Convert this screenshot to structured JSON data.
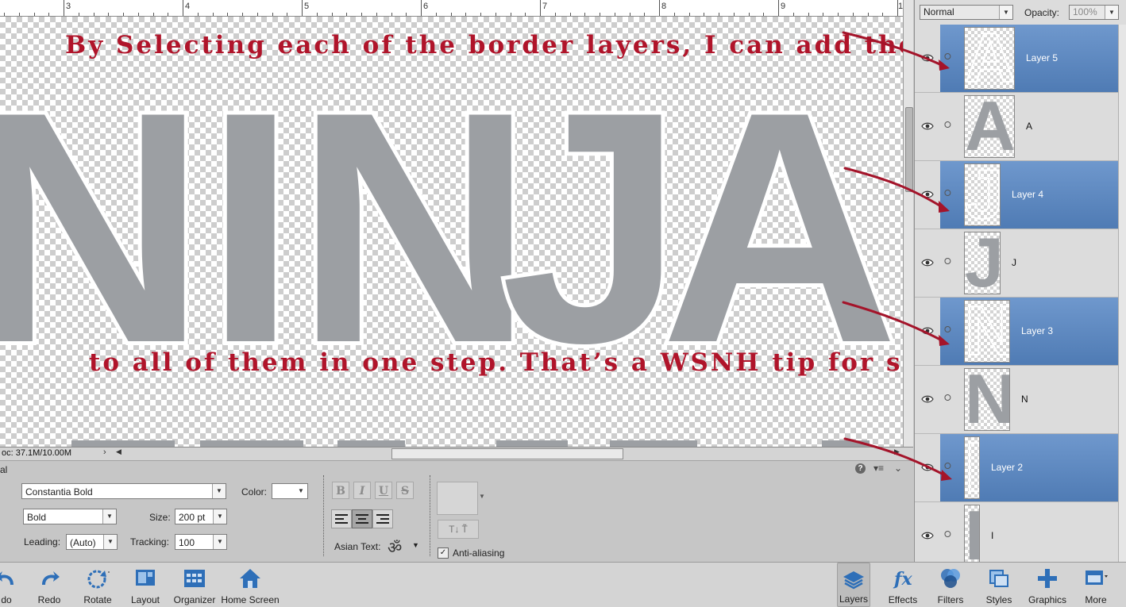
{
  "ruler": {
    "numbers": [
      "3",
      "4",
      "5",
      "6",
      "7",
      "8",
      "9",
      "1"
    ]
  },
  "canvas": {
    "letters": [
      "N",
      "I",
      "N",
      "J",
      "A"
    ],
    "caption_top": "By Selecting each of the border layers, I can add the Style",
    "caption_bottom": "to all of them in one step. That’s a WSNH tip for sure!",
    "doc_info": "oc: 37.1M/10.00M",
    "colors": {
      "letter_fill": "#9c9fa3",
      "letter_border": "#ffffff",
      "caption": "#b0142a"
    }
  },
  "options_bar": {
    "mode_label": "al",
    "font_family": "Constantia Bold",
    "font_style": "Bold",
    "color_label": "Color:",
    "size_label": "Size:",
    "size_value": "200 pt",
    "leading_label": "Leading:",
    "leading_value": "(Auto)",
    "tracking_label": "Tracking:",
    "tracking_value": "100",
    "format_buttons": [
      "B",
      "I",
      "U",
      "S"
    ],
    "asian_text_label": "Asian Text:",
    "anti_aliasing_label": "Anti-aliasing",
    "anti_aliasing_checked": true,
    "help_icon": "question-icon",
    "menu_icon": "list-menu-icon"
  },
  "taskbar": {
    "left": [
      {
        "label": "do",
        "icon": "undo-icon"
      },
      {
        "label": "Redo",
        "icon": "redo-icon"
      },
      {
        "label": "Rotate",
        "icon": "rotate-icon"
      },
      {
        "label": "Layout",
        "icon": "layout-icon"
      },
      {
        "label": "Organizer",
        "icon": "organizer-icon"
      },
      {
        "label": "Home Screen",
        "icon": "home-icon"
      }
    ],
    "right": [
      {
        "label": "Layers",
        "icon": "layers-icon",
        "active": true
      },
      {
        "label": "Effects",
        "icon": "fx-icon"
      },
      {
        "label": "Filters",
        "icon": "filters-icon"
      },
      {
        "label": "Styles",
        "icon": "styles-icon"
      },
      {
        "label": "Graphics",
        "icon": "plus-icon"
      },
      {
        "label": "More",
        "icon": "more-icon"
      }
    ]
  },
  "layers_panel": {
    "blend_mode": "Normal",
    "opacity_label": "Opacity:",
    "opacity_value": "100%",
    "selection_color": "#5a86c0",
    "layers": [
      {
        "name": "Layer 5",
        "selected": true,
        "thumb_letter": "A",
        "thumb_style": "outline"
      },
      {
        "name": "A",
        "selected": false,
        "thumb_letter": "A",
        "thumb_style": "fill"
      },
      {
        "name": "Layer 4",
        "selected": true,
        "thumb_letter": "J",
        "thumb_style": "outline"
      },
      {
        "name": "J",
        "selected": false,
        "thumb_letter": "J",
        "thumb_style": "fill"
      },
      {
        "name": "Layer 3",
        "selected": true,
        "thumb_letter": "N",
        "thumb_style": "outline"
      },
      {
        "name": "N",
        "selected": false,
        "thumb_letter": "N",
        "thumb_style": "fill"
      },
      {
        "name": "Layer 2",
        "selected": true,
        "thumb_letter": "I",
        "thumb_style": "outline"
      },
      {
        "name": "I",
        "selected": false,
        "thumb_letter": "I",
        "thumb_style": "fill"
      }
    ]
  }
}
